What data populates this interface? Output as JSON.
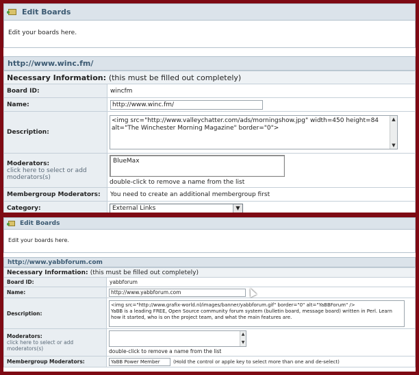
{
  "panel1": {
    "header_title": "Edit Boards",
    "intro_text": "Edit your boards here.",
    "board_url": "http://www.winc.fm/",
    "necessary_info_bold": "Necessary Information:",
    "necessary_info_note": "(this must be filled out completely)",
    "board_id_label": "Board ID:",
    "board_id_value": "wincfm",
    "name_label": "Name:",
    "name_value": "http://www.winc.fm/",
    "description_label": "Description:",
    "description_value": "<img src=\"http://www.valleychatter.com/ads/morningshow.jpg\" width=450 height=84 alt=\"The Winchester Morning Magazine\" border=\"0\">",
    "moderators_label": "Moderators:",
    "moderators_sublabel": "click here to select or add moderators(s)",
    "moderators_list": [
      "BlueMax"
    ],
    "moderators_hint": "double-click to remove a name from the list",
    "membergroup_label": "Membergroup Moderators:",
    "membergroup_value": "You need to create an additional membergroup first",
    "category_label": "Category:",
    "category_selected": "External Links"
  },
  "panel2": {
    "header_title": "Edit Boards",
    "intro_text": "Edit your boards here.",
    "board_url": "http://www.yabbforum.com",
    "necessary_info_bold": "Necessary Information:",
    "necessary_info_note": "(this must be filled out completely)",
    "board_id_label": "Board ID:",
    "board_id_value": "yabbforum",
    "name_label": "Name:",
    "name_value": "http://www.yabbforum.com",
    "description_label": "Description:",
    "description_line1": "<img src=\"http://www.grafix-world.nl/images/banner/yabbforum.gif\" border=\"0\" alt=\"YaBBForum\" />",
    "description_line2": "YaBB is a leading FREE, Open Source community forum system (bulletin board, message board) written in Perl. Learn how it started, who is on the project team, and what the main features are.",
    "moderators_label": "Moderators:",
    "moderators_sublabel": "click here to select or add moderators(s)",
    "moderators_hint": "double-click to remove a name from the list",
    "membergroup_label": "Membergroup Moderators:",
    "membergroup_option": "YaBB Power Member",
    "membergroup_hint": "(Hold the control or apple key to select more than one and de-select)"
  }
}
